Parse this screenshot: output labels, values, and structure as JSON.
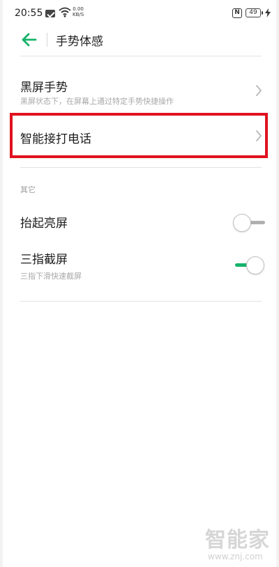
{
  "status_bar": {
    "time": "20:55",
    "net_speed_value": "0.00",
    "net_speed_unit": "KB/S",
    "nfc_label": "N",
    "battery_level": "49"
  },
  "header": {
    "title": "手势体感"
  },
  "rows": {
    "black_screen_gesture": {
      "title": "黑屏手势",
      "subtitle": "黑屏状态下，在屏幕上通过特定手势快捷操作"
    },
    "smart_call": {
      "title": "智能接打电话"
    }
  },
  "section_other": {
    "label": "其它",
    "raise_to_wake": {
      "title": "抬起亮屏",
      "enabled": false
    },
    "three_finger_screenshot": {
      "title": "三指截屏",
      "subtitle": "三指下滑快速截屏",
      "enabled": true
    }
  },
  "colors": {
    "accent_green": "#15b36a",
    "highlight_red": "#e0121f"
  },
  "watermark": {
    "logo": "智能家",
    "url": "www.znj.com"
  }
}
